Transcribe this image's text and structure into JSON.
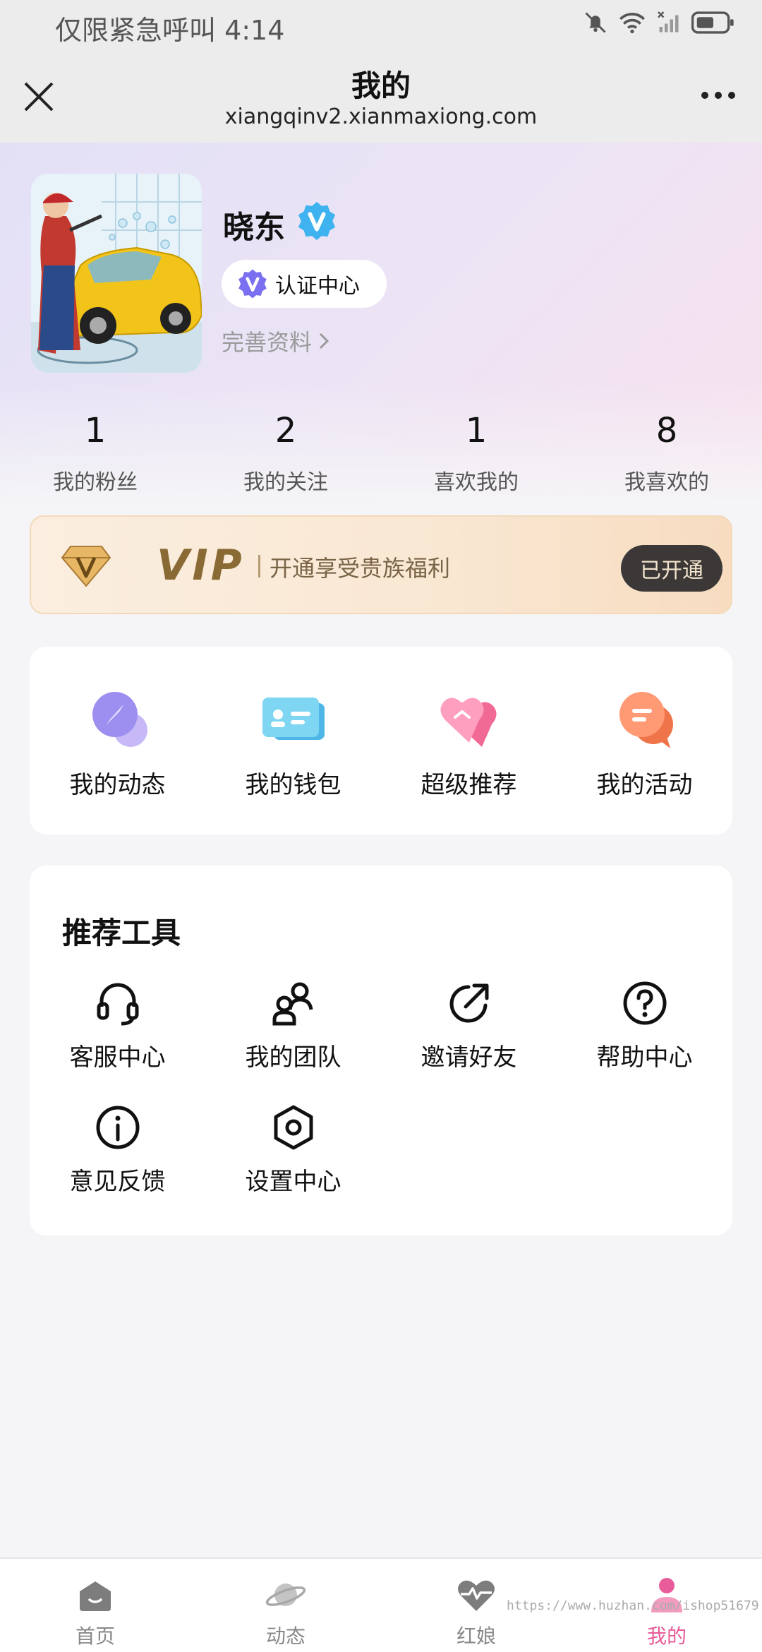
{
  "status_bar": {
    "left_text": "仅限紧急呼叫 4:14",
    "icons": [
      "bell-muted-icon",
      "wifi-icon",
      "signal-off-icon",
      "battery-icon"
    ]
  },
  "header": {
    "title": "我的",
    "url": "xiangqinv2.xianmaxiong.com",
    "close_icon": "close-icon",
    "more_icon": "more-icon"
  },
  "profile": {
    "name": "晓东",
    "verified_icon": "verified-badge-icon",
    "cert_label": "认证中心",
    "complete_label": "完善资料",
    "stats": [
      {
        "value": "1",
        "label": "我的粉丝"
      },
      {
        "value": "2",
        "label": "我的关注"
      },
      {
        "value": "1",
        "label": "喜欢我的"
      },
      {
        "value": "8",
        "label": "我喜欢的"
      }
    ]
  },
  "vip": {
    "word": "VIP",
    "slogan": "开通享受贵族福利",
    "button": "已开通"
  },
  "features": [
    {
      "label": "我的动态",
      "icon": "compass-icon"
    },
    {
      "label": "我的钱包",
      "icon": "wallet-card-icon"
    },
    {
      "label": "超级推荐",
      "icon": "heart-icon"
    },
    {
      "label": "我的活动",
      "icon": "chat-bubble-icon"
    }
  ],
  "tools": {
    "title": "推荐工具",
    "items": [
      {
        "label": "客服中心",
        "icon": "headset-icon"
      },
      {
        "label": "我的团队",
        "icon": "team-icon"
      },
      {
        "label": "邀请好友",
        "icon": "share-arrow-icon"
      },
      {
        "label": "帮助中心",
        "icon": "question-icon"
      },
      {
        "label": "意见反馈",
        "icon": "info-icon"
      },
      {
        "label": "设置中心",
        "icon": "settings-hex-icon"
      }
    ]
  },
  "bottom_nav": [
    {
      "label": "首页",
      "icon": "home-icon",
      "active": false
    },
    {
      "label": "动态",
      "icon": "planet-icon",
      "active": false
    },
    {
      "label": "红娘",
      "icon": "heart-pulse-icon",
      "active": false
    },
    {
      "label": "我的",
      "icon": "person-icon",
      "active": true
    }
  ],
  "watermark": "https://www.huzhan.com/ishop51679",
  "colors": {
    "active_nav": "#e85c99",
    "vip_text": "#8a6a34",
    "vip_button_bg": "#3b3837",
    "verified_blue": "#3fb3f0"
  }
}
